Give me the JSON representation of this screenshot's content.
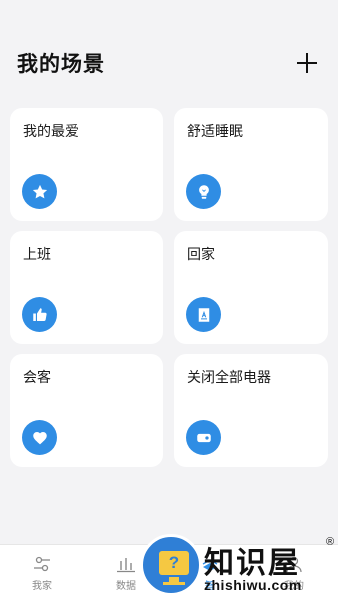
{
  "header": {
    "title": "我的场景",
    "add_icon": "plus-icon"
  },
  "accent_color": "#2f8de4",
  "scenes": [
    {
      "label": "我的最爱",
      "icon": "star-icon"
    },
    {
      "label": "舒适睡眠",
      "icon": "lightbulb-icon"
    },
    {
      "label": "上班",
      "icon": "thumbs-up-icon"
    },
    {
      "label": "回家",
      "icon": "door-icon"
    },
    {
      "label": "会客",
      "icon": "heart-icon"
    },
    {
      "label": "关闭全部电器",
      "icon": "toggle-off-icon"
    }
  ],
  "tabbar": {
    "tabs": [
      {
        "label": "我家",
        "icon": "home-sliders-icon"
      },
      {
        "label": "数据",
        "icon": "bar-chart-icon"
      },
      {
        "label": "智",
        "icon": "smart-icon"
      },
      {
        "label": "我的",
        "icon": "user-icon"
      }
    ]
  },
  "watermark": {
    "cn_text": "知识屋",
    "url": "zhishiwu.com",
    "reg": "®",
    "badge_glyph": "?"
  }
}
